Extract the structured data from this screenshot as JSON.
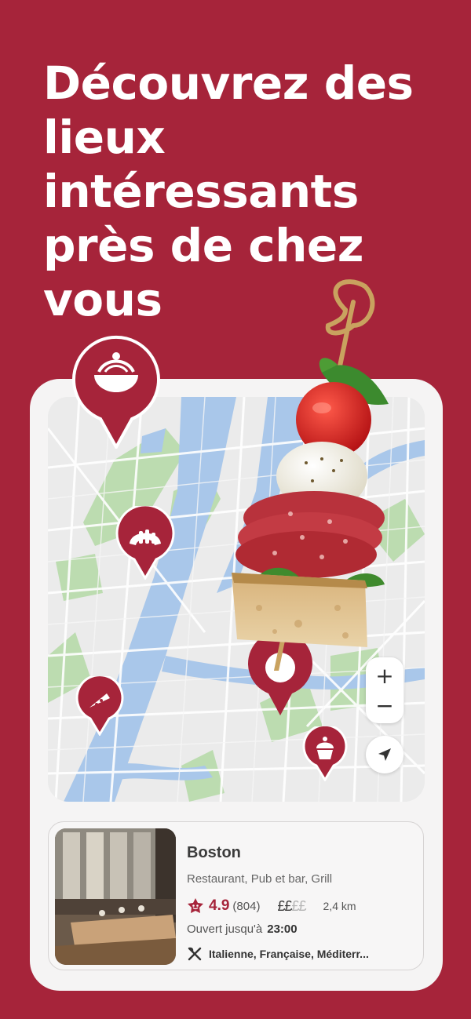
{
  "headline": "Découvrez des lieux intéressants près de chez vous",
  "map": {
    "zoom_in_label": "+",
    "zoom_out_label": "−",
    "pins": [
      {
        "icon": "pasta-bowl-icon"
      },
      {
        "icon": "croissant-icon"
      },
      {
        "icon": "pizza-slice-icon"
      },
      {
        "icon": "selected-location-dot"
      },
      {
        "icon": "cupcake-icon"
      }
    ]
  },
  "restaurant": {
    "name": "Boston",
    "type": "Restaurant, Pub et bar, Grill",
    "rating": "4.9",
    "reviews": "(804)",
    "price_active": "££",
    "price_inactive": "££",
    "distance": "2,4 km",
    "open_label": "Ouvert jusqu'à",
    "open_time": "23:00",
    "cuisines": "Italienne, Française, Méditerr..."
  },
  "colors": {
    "brand": "#a6243a",
    "card_bg": "#f5f4f4",
    "water": "#a9c7ea",
    "park": "#bcdcb0"
  }
}
